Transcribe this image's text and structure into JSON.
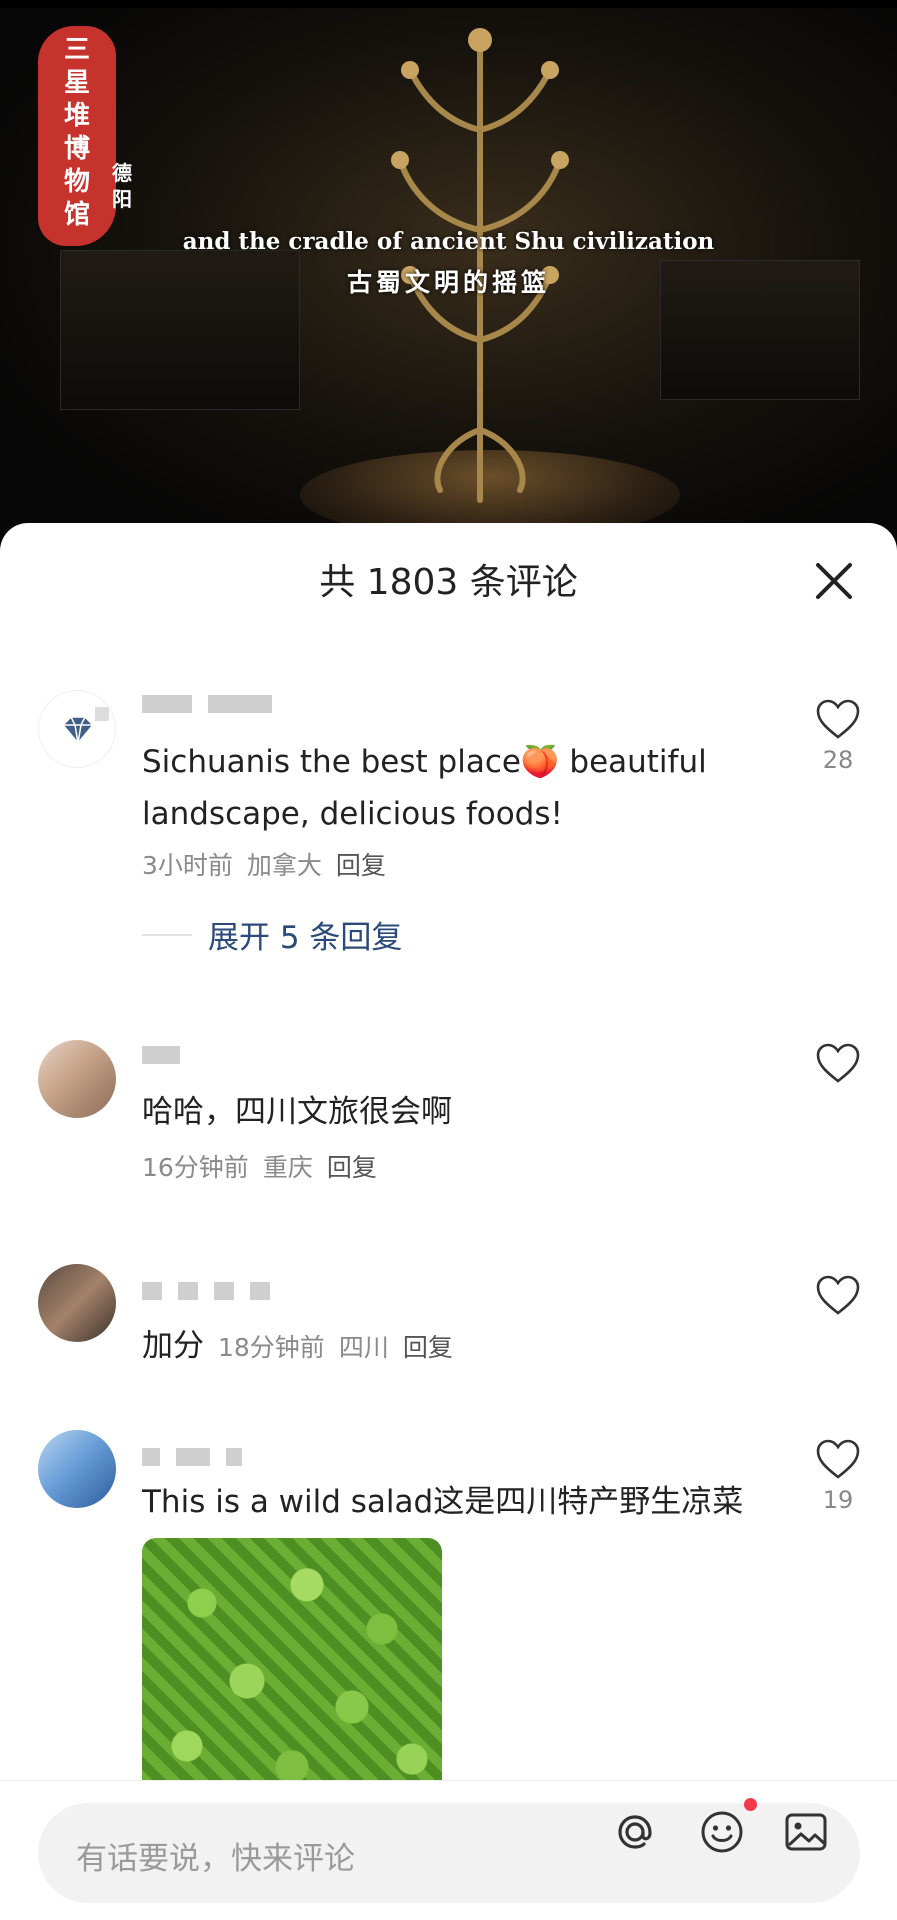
{
  "video": {
    "logo_text": [
      "三",
      "星",
      "堆",
      "博",
      "物",
      "馆"
    ],
    "logo_sub": "德阳",
    "subtitle_en": "and the cradle of ancient Shu civilization",
    "subtitle_zh": "古蜀文明的摇篮"
  },
  "sheet": {
    "title": "共 1803 条评论",
    "close_icon": "close-icon"
  },
  "comments": [
    {
      "text": "Sichuanis the best place🍑 beautiful landscape, delicious foods!",
      "time": "3小时前",
      "location": "加拿大",
      "reply": "回复",
      "likes": "28",
      "expand_label": "展开 5 条回复"
    },
    {
      "text": "哈哈，四川文旅很会啊",
      "time": "16分钟前",
      "location": "重庆",
      "reply": "回复",
      "likes": ""
    },
    {
      "text": "加分",
      "time": "18分钟前",
      "location": "四川",
      "reply": "回复",
      "likes": ""
    },
    {
      "text": "This is a wild salad这是四川特产野生凉菜",
      "likes": "19"
    }
  ],
  "input": {
    "placeholder": "有话要说，快来评论",
    "icons": [
      "at-icon",
      "emoji-icon",
      "image-icon"
    ]
  }
}
